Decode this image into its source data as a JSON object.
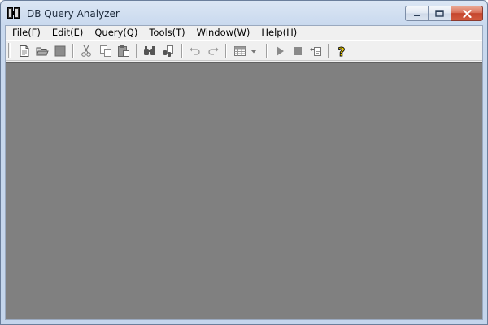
{
  "window": {
    "title": "DB Query Analyzer"
  },
  "menubar": {
    "items": [
      {
        "label": "File(F)"
      },
      {
        "label": "Edit(E)"
      },
      {
        "label": "Query(Q)"
      },
      {
        "label": "Tools(T)"
      },
      {
        "label": "Window(W)"
      },
      {
        "label": "Help(H)"
      }
    ]
  },
  "toolbar": {
    "icons": [
      "new-document-icon",
      "open-folder-icon",
      "save-icon",
      "cut-icon",
      "copy-icon",
      "paste-icon",
      "find-icon",
      "replace-icon",
      "undo-icon",
      "redo-icon",
      "results-grid-icon",
      "dropdown-arrow-icon",
      "execute-icon",
      "stop-icon",
      "parse-icon",
      "help-icon"
    ]
  },
  "colors": {
    "workspace": "#808080",
    "chrome": "#f0f0f0",
    "close_button": "#c4452d"
  }
}
